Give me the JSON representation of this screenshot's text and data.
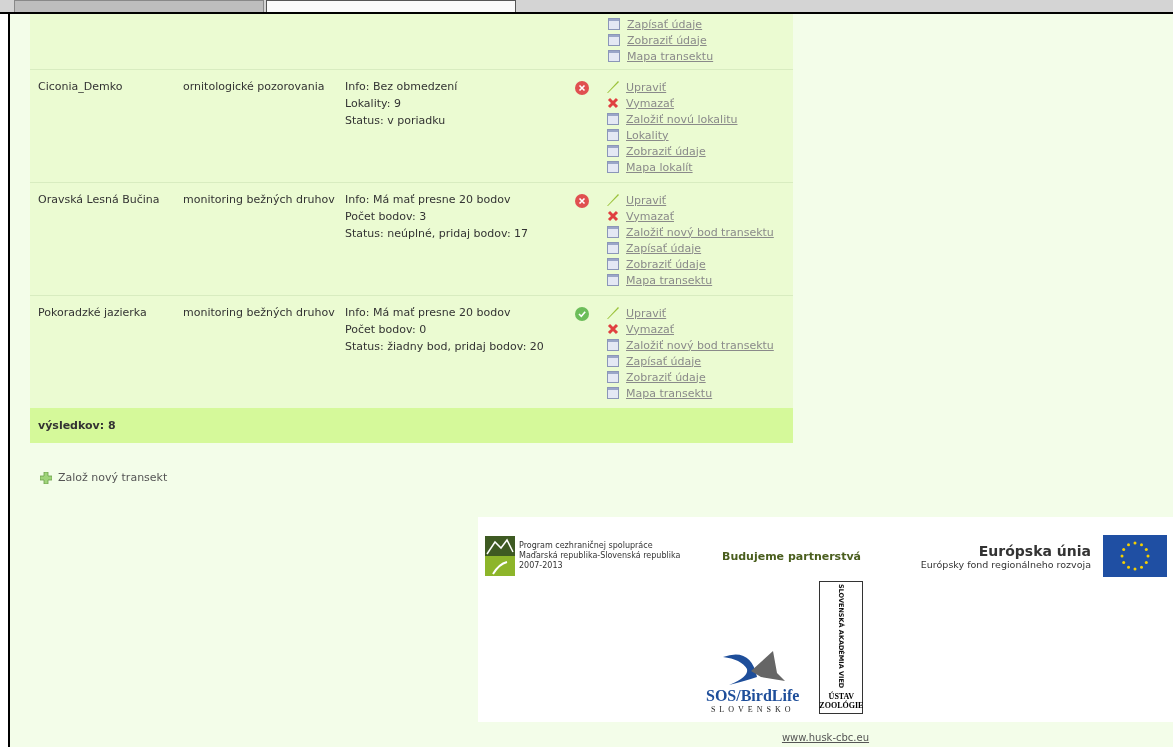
{
  "browser_tabs": [
    {
      "selected": false
    },
    {
      "selected": true
    }
  ],
  "partial_row": {
    "actions": [
      {
        "kind": "page",
        "label": "Zapísať údaje"
      },
      {
        "kind": "page",
        "label": "Zobraziť údaje"
      },
      {
        "kind": "page",
        "label": "Mapa transektu"
      }
    ]
  },
  "rows": [
    {
      "name": "Ciconia_Demko",
      "type": "ornitologické pozorovania",
      "info": [
        "Info: Bez obmedzení",
        "Lokality: 9",
        "Status: v poriadku"
      ],
      "kind": "error",
      "actions": [
        {
          "kind": "edit",
          "label": "Upraviť"
        },
        {
          "kind": "delete",
          "label": "Vymazať"
        },
        {
          "kind": "page",
          "label": "Založiť novú lokalitu"
        },
        {
          "kind": "page",
          "label": "Lokality"
        },
        {
          "kind": "page",
          "label": "Zobraziť údaje"
        },
        {
          "kind": "page",
          "label": "Mapa lokalít"
        }
      ]
    },
    {
      "name": "Oravská Lesná Bučina",
      "type": "monitoring bežných druhov",
      "info": [
        "Info: Má mať presne 20 bodov",
        "Počet bodov: 3",
        "Status: neúplné, pridaj bodov: 17"
      ],
      "kind": "error",
      "actions": [
        {
          "kind": "edit",
          "label": "Upraviť"
        },
        {
          "kind": "delete",
          "label": "Vymazať"
        },
        {
          "kind": "page",
          "label": "Založiť nový bod transektu"
        },
        {
          "kind": "page",
          "label": "Zapísať údaje"
        },
        {
          "kind": "page",
          "label": "Zobraziť údaje"
        },
        {
          "kind": "page",
          "label": "Mapa transektu"
        }
      ]
    },
    {
      "name": "Pokoradzké jazierka",
      "type": "monitoring bežných druhov",
      "info": [
        "Info: Má mať presne 20 bodov",
        "Počet bodov: 0",
        "Status: žiadny bod, pridaj bodov: 20"
      ],
      "kind": "ok",
      "actions": [
        {
          "kind": "edit",
          "label": "Upraviť"
        },
        {
          "kind": "delete",
          "label": "Vymazať"
        },
        {
          "kind": "page",
          "label": "Založiť nový bod transektu"
        },
        {
          "kind": "page",
          "label": "Zapísať údaje"
        },
        {
          "kind": "page",
          "label": "Zobraziť údaje"
        },
        {
          "kind": "page",
          "label": "Mapa transektu"
        }
      ]
    }
  ],
  "results": "výsledkov: 8",
  "add_link": "Založ nový transekt",
  "footer": {
    "program": [
      "Program cezhraničnej spolupráce",
      "Maďarská republika-Slovenská republika",
      "2007-2013"
    ],
    "slogan": "Budujeme partnerstvá",
    "eu_title": "Európska únia",
    "eu_subtitle": "Európsky fond regionálneho rozvoja",
    "birdlife": "SOS/BirdLife",
    "birdlife_country": "SLOVENSKO",
    "academy": "SLOVENSKÁ AKADÉMIA VIED",
    "institute": [
      "ÚSTAV",
      "ZOOLÓGIE"
    ]
  },
  "footer_link": "www.husk-cbc.eu"
}
